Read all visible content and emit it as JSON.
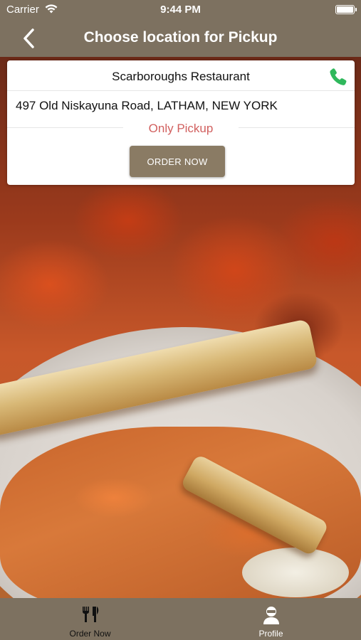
{
  "status_bar": {
    "carrier": "Carrier",
    "time": "9:44 PM",
    "wifi_icon": "wifi-icon",
    "battery_icon": "battery-icon"
  },
  "nav": {
    "title": "Choose location for Pickup",
    "back_icon": "chevron-left-icon"
  },
  "location_card": {
    "name": "Scarboroughs Restaurant",
    "address": "497 Old Niskayuna Road, LATHAM, NEW YORK",
    "pickup_label": "Only Pickup",
    "order_button_label": "ORDER NOW",
    "phone_icon": "phone-icon"
  },
  "tab_bar": {
    "tabs": [
      {
        "label": "Order Now",
        "icon": "fork-knife-icon"
      },
      {
        "label": "Profile",
        "icon": "user-icon"
      }
    ]
  },
  "colors": {
    "bar": "#7d7160",
    "button": "#8a7b64",
    "pickup_text": "#d1605f",
    "phone": "#2fb85c"
  }
}
